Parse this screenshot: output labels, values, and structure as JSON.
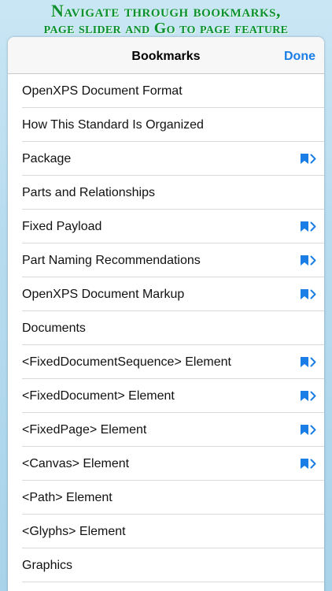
{
  "promo": {
    "line1": "Navigate through bookmarks,",
    "line2": "page slider and Go to page feature"
  },
  "navbar": {
    "title": "Bookmarks",
    "done_label": "Done"
  },
  "colors": {
    "accent": "#1a7ee6",
    "promo_text": "#0b8f2f"
  },
  "bookmarks": [
    {
      "label": "OpenXPS Document Format",
      "has_children": false
    },
    {
      "label": "How This Standard Is Organized",
      "has_children": false
    },
    {
      "label": "Package",
      "has_children": true
    },
    {
      "label": "Parts and Relationships",
      "has_children": false
    },
    {
      "label": "Fixed Payload",
      "has_children": true
    },
    {
      "label": "Part Naming Recommendations",
      "has_children": true
    },
    {
      "label": "OpenXPS Document Markup",
      "has_children": true
    },
    {
      "label": "Documents",
      "has_children": false
    },
    {
      "label": "<FixedDocumentSequence> Element",
      "has_children": true
    },
    {
      "label": "<FixedDocument> Element",
      "has_children": true
    },
    {
      "label": "<FixedPage> Element",
      "has_children": true
    },
    {
      "label": "<Canvas> Element",
      "has_children": true
    },
    {
      "label": "<Path> Element",
      "has_children": false
    },
    {
      "label": "<Glyphs> Element",
      "has_children": false
    },
    {
      "label": "Graphics",
      "has_children": false
    }
  ],
  "icons": {
    "expand": "bookmark-icon",
    "disclosure": "chevron-right-icon"
  }
}
